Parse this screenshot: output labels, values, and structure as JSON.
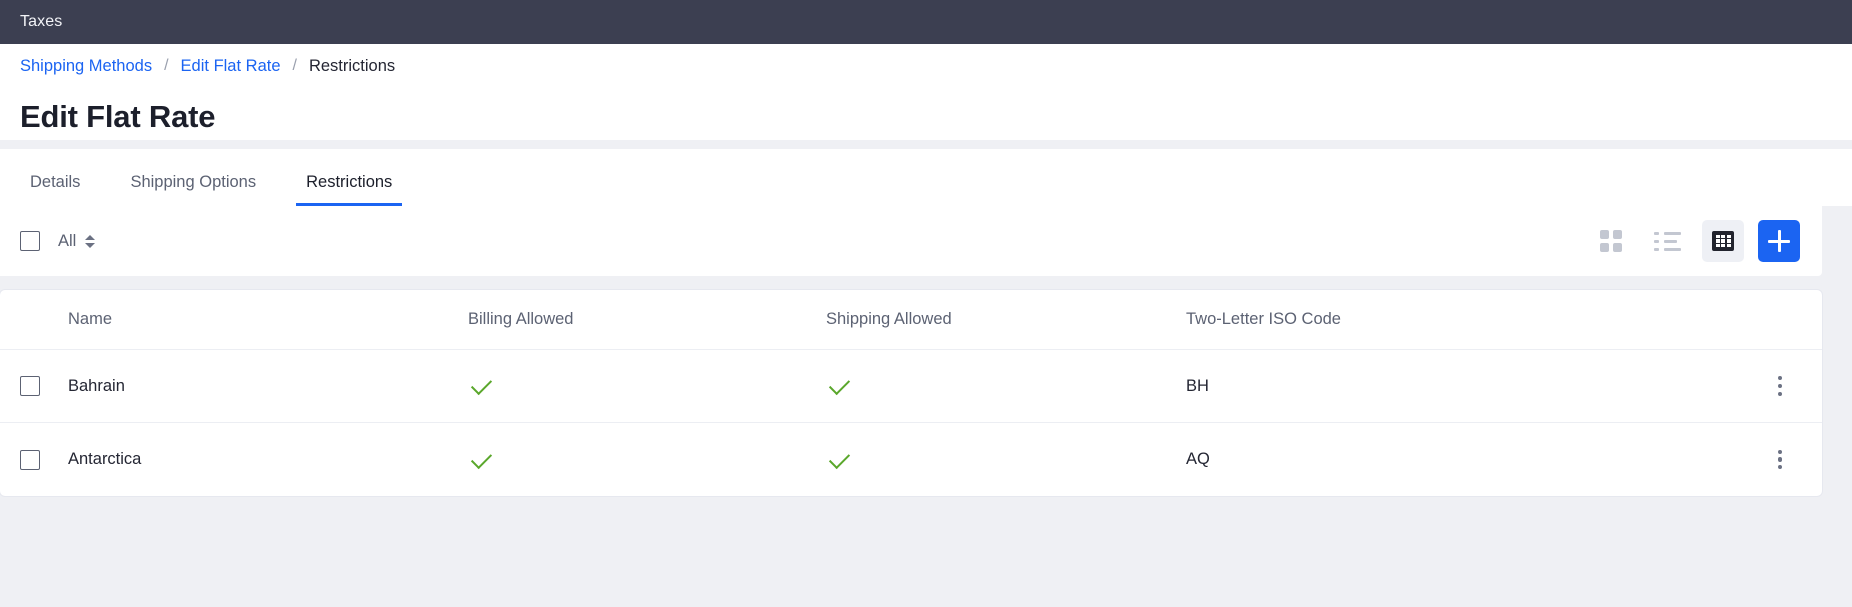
{
  "topbar": {
    "title": "Taxes"
  },
  "breadcrumb": {
    "items": [
      {
        "label": "Shipping Methods",
        "type": "link"
      },
      {
        "label": "Edit Flat Rate",
        "type": "link"
      },
      {
        "label": "Restrictions",
        "type": "current"
      }
    ],
    "separator": "/"
  },
  "page": {
    "title": "Edit Flat Rate"
  },
  "tabs": [
    {
      "label": "Details",
      "active": false
    },
    {
      "label": "Shipping Options",
      "active": false
    },
    {
      "label": "Restrictions",
      "active": true
    }
  ],
  "toolbar": {
    "select_all_label": "All",
    "views": [
      {
        "icon": "tile-view-icon",
        "active": false
      },
      {
        "icon": "list-view-icon",
        "active": false
      },
      {
        "icon": "table-view-icon",
        "active": true
      }
    ],
    "add_button_icon": "plus-icon"
  },
  "table": {
    "columns": [
      {
        "key": "name",
        "label": "Name"
      },
      {
        "key": "billing",
        "label": "Billing Allowed"
      },
      {
        "key": "shipping",
        "label": "Shipping Allowed"
      },
      {
        "key": "iso",
        "label": "Two-Letter ISO Code"
      }
    ],
    "rows": [
      {
        "name": "Bahrain",
        "billing": "check",
        "shipping": "check",
        "iso": "BH",
        "selected": false
      },
      {
        "name": "Antarctica",
        "billing": "check",
        "shipping": "check",
        "iso": "AQ",
        "selected": false
      }
    ]
  },
  "colors": {
    "topbar_bg": "#3c3f51",
    "page_bg": "#eff0f4",
    "accent": "#1b64f2",
    "link": "#1b64f2",
    "check_green": "#5aa72b",
    "text_primary": "#242633",
    "text_muted": "#5c6273"
  }
}
